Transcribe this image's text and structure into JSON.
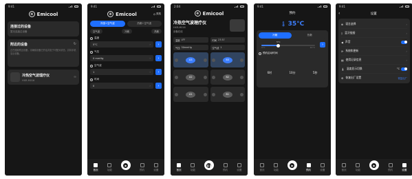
{
  "status": {
    "time": "9:41",
    "time_alt": "2:04"
  },
  "brand": {
    "name": "Emicool"
  },
  "screen1": {
    "connected_title": "连接过的设备",
    "connected_sub": "暂无连接过设备",
    "nearby_title": "附近的设备",
    "nearby_hint": "正在搜索附近设备，请确保设备已开启并处于可配对状态，并将手机靠近设备。",
    "device_name": "冷热空气波理疗仪",
    "device_id": "HXR-M016"
  },
  "screen2": {
    "power_label": "关机",
    "mode_tabs": [
      "冷感+空气波",
      "热敷+空气波"
    ],
    "chips": [
      "空气波",
      "冷敷",
      "热敷"
    ],
    "params": [
      {
        "label": "温度",
        "value": "5°C"
      },
      {
        "label": "气压",
        "value": "0 mmHg"
      },
      {
        "label": "空气波",
        "value": "1"
      },
      {
        "label": "时间",
        "value": "0"
      }
    ]
  },
  "screen3": {
    "title": "冷热空气波理疗仪",
    "device_id": "HXR-M016",
    "sub": "设备在线",
    "stats": [
      {
        "label": "温度",
        "value": "4°F"
      },
      {
        "label": "时间",
        "value": "27:37"
      }
    ],
    "stats2": [
      {
        "label": "气压",
        "value": "50mmHg"
      },
      {
        "label": "空气波",
        "value": "1"
      }
    ],
    "chambers": [
      "A3",
      "B3",
      "A2",
      "B2",
      "A1",
      "B1"
    ]
  },
  "screen4": {
    "header": "预约",
    "temp": "35°C",
    "mode_tabs": [
      "冷敷",
      "热敷"
    ],
    "slider_value": "5°C",
    "slider_min": "0°C",
    "slider_max": "40°C",
    "schedule_label": "预约启动时间",
    "time_cols": [
      "6时",
      "10分",
      "5秒"
    ]
  },
  "screen5": {
    "header": "设置",
    "items": [
      {
        "label": "语言选择",
        "right": ""
      },
      {
        "label": "蓝牙链接",
        "right": ""
      },
      {
        "label": "声音",
        "right": "toggle"
      },
      {
        "label": "系统和更新",
        "right": ""
      },
      {
        "label": "使用记录信息",
        "right": ""
      },
      {
        "label": "温度显示切换",
        "right": "°C"
      },
      {
        "label": "恢复出厂设置",
        "right": "恢复出厂"
      }
    ]
  },
  "tabbar": [
    "首页",
    "功能",
    "",
    "预约",
    "设置"
  ],
  "colors": {
    "accent": "#1f6fff",
    "bg": "#161616",
    "card": "#2a2a2a"
  }
}
